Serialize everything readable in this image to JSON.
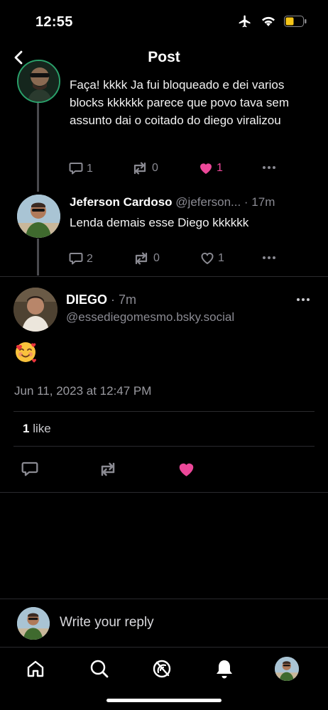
{
  "status_bar": {
    "time": "12:55",
    "icons": [
      "airplane-icon",
      "wifi-icon",
      "battery-icon"
    ],
    "battery_color": "#f5c518"
  },
  "header": {
    "title": "Post",
    "back_icon": "chevron-left-icon"
  },
  "thread": [
    {
      "text": "Faça! kkkk Ja fui bloqueado e dei varios blocks kkkkkk parece que povo tava sem assunto dai o coitado do diego viralizou",
      "actions": {
        "replies": "1",
        "reposts": "0",
        "likes": "1",
        "liked": true
      }
    },
    {
      "author_name": "Jeferson Cardoso",
      "author_handle": "@jeferson...",
      "time": "· 17m",
      "text": "Lenda demais esse Diego kkkkkk",
      "actions": {
        "replies": "2",
        "reposts": "0",
        "likes": "1",
        "liked": false
      }
    }
  ],
  "main_post": {
    "author_name": "DIEGO",
    "time": "· 7m",
    "handle": "@essediegomesmo.bsky.social",
    "body_emoji": "smiling-face-with-hearts",
    "timestamp": "Jun 11, 2023 at 12:47 PM",
    "like_count": "1",
    "like_label": "like",
    "liked": true
  },
  "composer": {
    "placeholder": "Write your reply"
  },
  "tabbar": {
    "items": [
      "home-icon",
      "search-icon",
      "feeds-icon",
      "notifications-icon",
      "profile-avatar"
    ]
  },
  "colors": {
    "background": "#000000",
    "like_pink": "#ec4899",
    "muted": "#8a8a92",
    "divider": "#2a2a2e"
  }
}
